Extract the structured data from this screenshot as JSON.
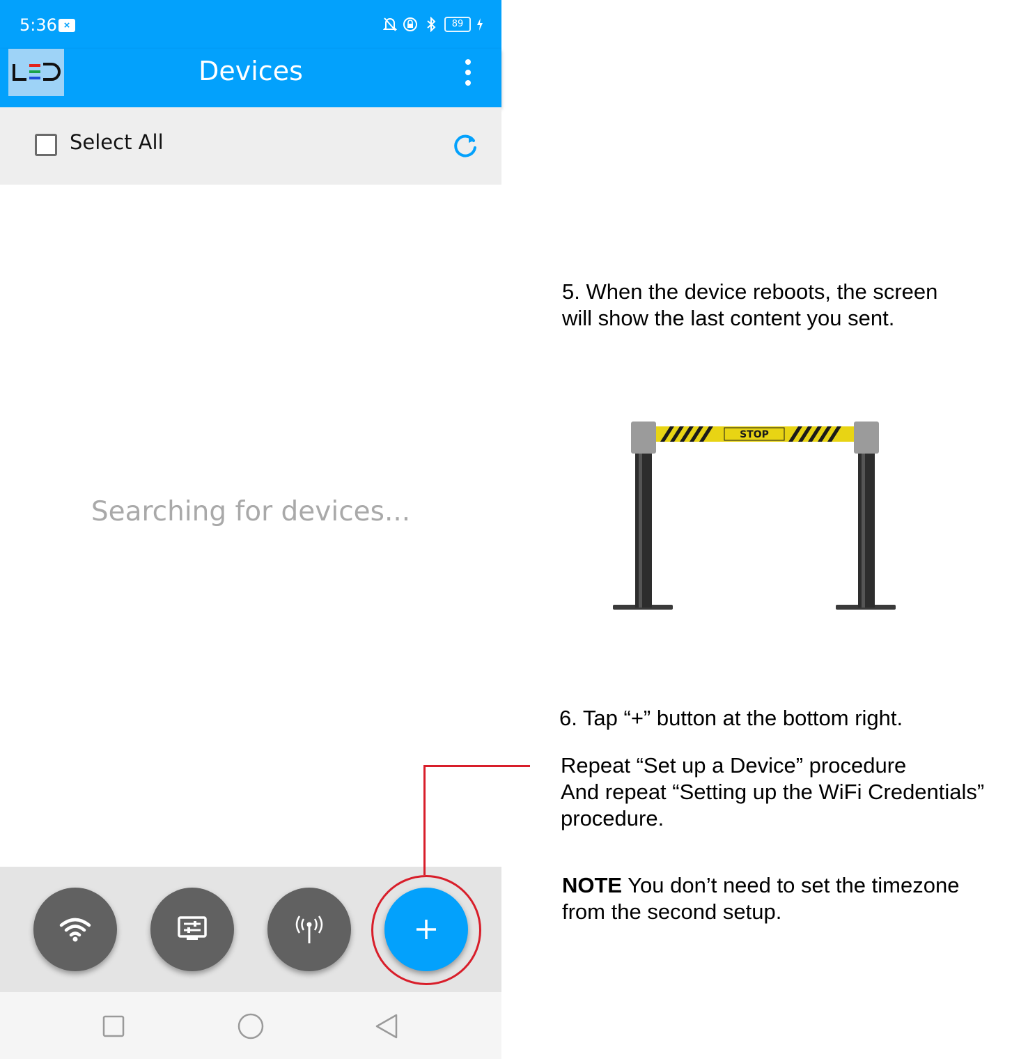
{
  "status_bar": {
    "time": "5:36",
    "battery": "89"
  },
  "app_bar": {
    "title": "Devices",
    "logo_text": "LED"
  },
  "select_all": {
    "label": "Select All",
    "checked": false
  },
  "main": {
    "status_text": "Searching for devices..."
  },
  "bottom_actions": [
    {
      "icon": "wifi-icon"
    },
    {
      "icon": "display-settings-icon"
    },
    {
      "icon": "antenna-icon"
    },
    {
      "icon": "plus-icon",
      "label": "+"
    }
  ],
  "instructions": {
    "step5": {
      "line1": "5. When the device reboots, the screen",
      "line2": "will show the last content you sent."
    },
    "illustration": {
      "sign_text": "STOP"
    },
    "step6": {
      "line1": "6. Tap “+” button at the bottom right.",
      "repeat1": "Repeat “Set up a Device” procedure",
      "repeat2": "And repeat “Setting up the WiFi Credentials”",
      "repeat3": "procedure."
    },
    "note": {
      "bold": "NOTE",
      "text1": " You don’t need to set the timezone",
      "text2": "from the second setup."
    }
  },
  "colors": {
    "primary": "#03a1fc",
    "callout": "#d81e2a",
    "action_gray": "#616161"
  }
}
